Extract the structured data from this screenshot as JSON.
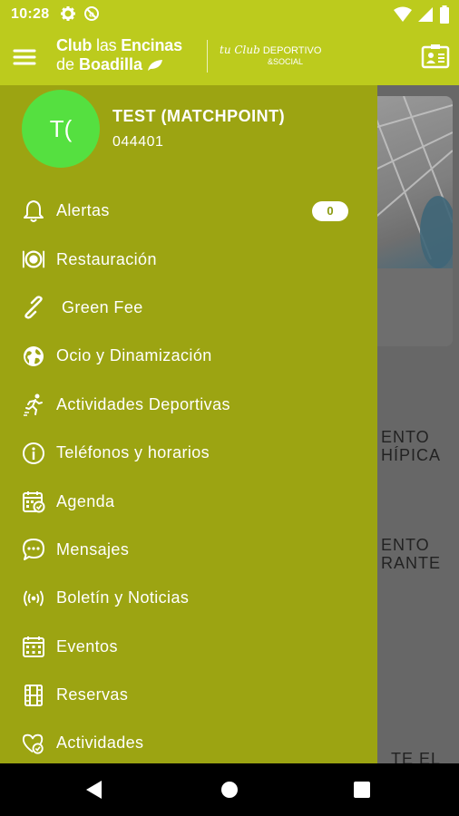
{
  "status_bar": {
    "time": "10:28",
    "left_icons": [
      "gear-icon",
      "no-disturb-icon"
    ],
    "right_icons": [
      "wifi-icon",
      "signal-icon",
      "battery-icon"
    ]
  },
  "app_bar": {
    "logo_line1_bold": "Club",
    "logo_line1_light": "las",
    "logo_line1_end": "Encinas",
    "logo_line2_light": "de",
    "logo_line2_bold": "Boadilla",
    "tagline_script": "tu Club",
    "tagline_main": "DEPORTIVO",
    "tagline_sub": "&SOCIAL"
  },
  "user": {
    "initials": "T(",
    "name": "TEST (MATCHPOINT)",
    "id": "044401"
  },
  "menu": {
    "items": [
      {
        "label": "Alertas",
        "icon": "bell-icon"
      },
      {
        "label": "Restauración",
        "icon": "plate-icon"
      },
      {
        "label": "Green Fee",
        "icon": "link-icon"
      },
      {
        "label": "Ocio y Dinamización",
        "icon": "globe-icon"
      },
      {
        "label": "Actividades Deportivas",
        "icon": "runner-icon"
      },
      {
        "label": "Teléfonos y horarios",
        "icon": "info-icon"
      },
      {
        "label": "Agenda",
        "icon": "calendar-check-icon"
      },
      {
        "label": "Mensajes",
        "icon": "chat-icon"
      },
      {
        "label": "Boletín y Noticias",
        "icon": "broadcast-icon"
      },
      {
        "label": "Eventos",
        "icon": "calendar-grid-icon"
      },
      {
        "label": "Reservas",
        "icon": "film-icon"
      },
      {
        "label": "Actividades",
        "icon": "heart-check-icon"
      }
    ],
    "alert_badge": "0"
  },
  "background": {
    "text1_line1": "ENTO",
    "text1_line2": "HÍPICA",
    "text2_line1": "ENTO",
    "text2_line2": "RANTE",
    "text3_line1": "TE EL"
  },
  "colors": {
    "app_bar": "#bccb1d",
    "drawer": "#9ca412",
    "avatar": "#55e040",
    "nav_bar": "#000000"
  }
}
